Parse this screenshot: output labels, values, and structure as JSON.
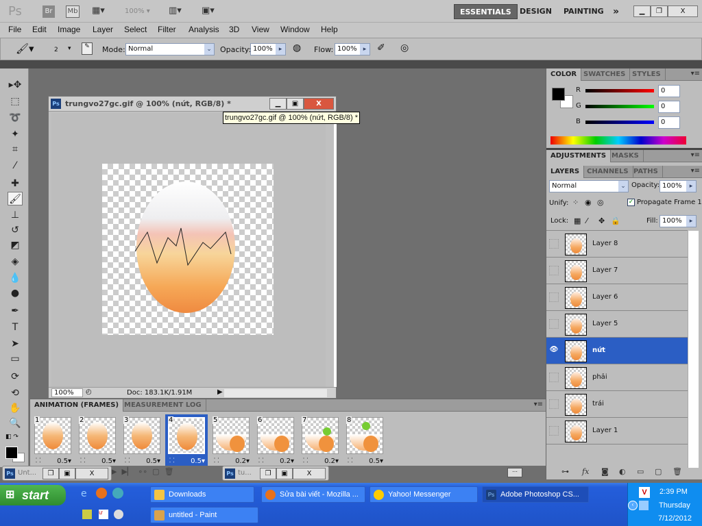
{
  "app": {
    "logo": "Ps",
    "bridge": "Br",
    "minibridge": "Mb",
    "zoom": "100%",
    "workspaces": [
      "ESSENTIALS",
      "DESIGN",
      "PAINTING"
    ],
    "more": "»"
  },
  "menu": [
    "File",
    "Edit",
    "Image",
    "Layer",
    "Select",
    "Filter",
    "Analysis",
    "3D",
    "View",
    "Window",
    "Help"
  ],
  "options": {
    "brush_size": "2",
    "mode_label": "Mode:",
    "mode_value": "Normal",
    "opacity_label": "Opacity:",
    "opacity_value": "100%",
    "flow_label": "Flow:",
    "flow_value": "100%"
  },
  "document": {
    "title": "trungvo27gc.gif @ 100% (nứt, RGB/8) *",
    "tooltip": "trungvo27gc.gif @ 100% (nứt, RGB/8) *",
    "zoom": "100%",
    "doc_info": "Doc: 183.1K/1.91M"
  },
  "color_panel": {
    "tabs": [
      "COLOR",
      "SWATCHES",
      "STYLES"
    ],
    "channels": [
      {
        "label": "R",
        "value": "0"
      },
      {
        "label": "G",
        "value": "0"
      },
      {
        "label": "B",
        "value": "0"
      }
    ],
    "foreground": "#000000",
    "background": "#ffffff"
  },
  "adjust_panel": {
    "tabs": [
      "ADJUSTMENTS",
      "MASKS"
    ]
  },
  "layers_panel": {
    "tabs": [
      "LAYERS",
      "CHANNELS",
      "PATHS"
    ],
    "blend_mode": "Normal",
    "opacity_label": "Opacity:",
    "opacity_value": "100%",
    "unify_label": "Unify:",
    "propagate_label": "Propagate Frame 1",
    "propagate_checked": true,
    "lock_label": "Lock:",
    "fill_label": "Fill:",
    "fill_value": "100%",
    "layers": [
      {
        "name": "Layer 8",
        "visible": false,
        "selected": false
      },
      {
        "name": "Layer 7",
        "visible": false,
        "selected": false
      },
      {
        "name": "Layer 6",
        "visible": false,
        "selected": false
      },
      {
        "name": "Layer 5",
        "visible": false,
        "selected": false
      },
      {
        "name": "nứt",
        "visible": true,
        "selected": true
      },
      {
        "name": "phải",
        "visible": false,
        "selected": false
      },
      {
        "name": "trái",
        "visible": false,
        "selected": false
      },
      {
        "name": "Layer 1",
        "visible": false,
        "selected": false
      }
    ]
  },
  "animation": {
    "tabs": [
      "ANIMATION (FRAMES)",
      "MEASUREMENT LOG"
    ],
    "selected_frame": 4,
    "frames": [
      {
        "num": "1",
        "delay": "0.5"
      },
      {
        "num": "2",
        "delay": "0.5"
      },
      {
        "num": "3",
        "delay": "0.5"
      },
      {
        "num": "4",
        "delay": "0.5"
      },
      {
        "num": "5",
        "delay": "0.2"
      },
      {
        "num": "6",
        "delay": "0.2"
      },
      {
        "num": "7",
        "delay": "0.2"
      },
      {
        "num": "8",
        "delay": "0.5"
      }
    ]
  },
  "minimized_docs": [
    "Unt...",
    "tu..."
  ],
  "taskbar": {
    "start": "start",
    "items": [
      "Downloads",
      "Sửa bài viết - Mozilla ...",
      "Yahoo! Messenger",
      "Adobe Photoshop CS...",
      "untitled - Paint"
    ],
    "time": "2:39 PM",
    "day": "Thursday",
    "date": "7/12/2012"
  }
}
